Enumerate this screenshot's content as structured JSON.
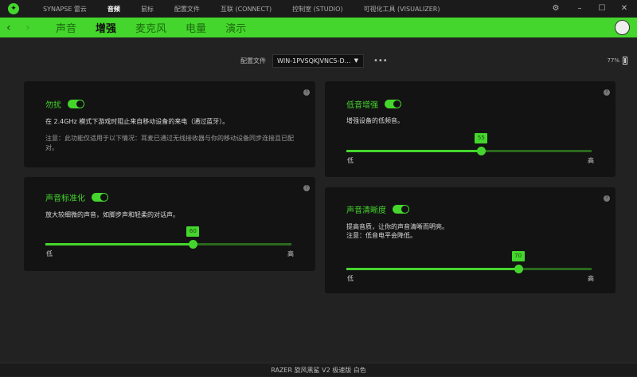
{
  "titlebar": {
    "items": [
      "SYNAPSE 雷云",
      "音频",
      "鼠标",
      "配置文件",
      "互联 (CONNECT)",
      "控制室 (STUDIO)",
      "可视化工具 (VISUALIZER)"
    ],
    "active": 1
  },
  "tabs": {
    "items": [
      "声音",
      "增强",
      "麦克风",
      "电量",
      "演示"
    ],
    "active": 1
  },
  "profile": {
    "label": "配置文件",
    "value": "WIN-1PVSQKJVNC5-D...",
    "more": "•••"
  },
  "battery": {
    "percent": "77%",
    "level": 0.77
  },
  "cards": {
    "dnd": {
      "title": "勿扰",
      "enabled": true,
      "desc": "在 2.4GHz 模式下游戏时阻止来自移动设备的来电（通过蓝牙）。",
      "note": "注意：此功能仅适用于以下情况：耳麦已通过无线接收器与你的移动设备同步连接且已配对。"
    },
    "norm": {
      "title": "声音标准化",
      "enabled": true,
      "desc": "放大较细微的声音，如脚步声和轻柔的对话声。",
      "value": 60,
      "value_label": "60",
      "low": "低",
      "high": "高"
    },
    "bass": {
      "title": "低音增强",
      "enabled": true,
      "desc": "增强设备的低频音。",
      "value": 55,
      "value_label": "55",
      "low": "低",
      "high": "高"
    },
    "clarity": {
      "title": "声音清晰度",
      "enabled": true,
      "desc": "提高音质，让你的声音清晰而明亮。",
      "note": "注意：低音电平会降低。",
      "value": 70,
      "value_label": "70",
      "low": "低",
      "high": "高"
    }
  },
  "help": "?",
  "status": "RAZER 旋风黑鲨 V2 极速版 白色"
}
